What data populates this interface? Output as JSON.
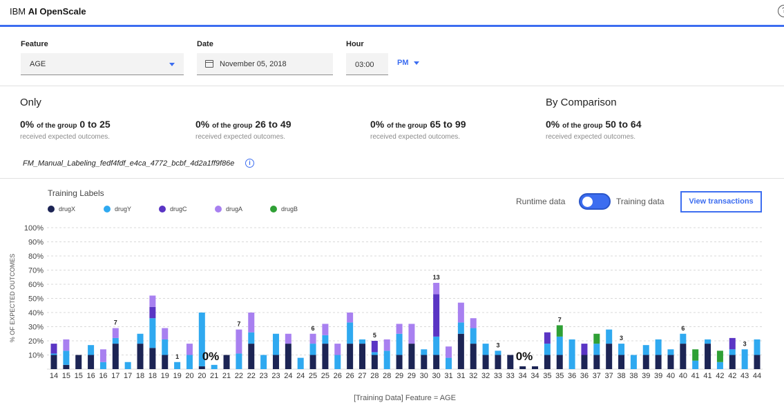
{
  "app": {
    "brand_prefix": "IBM",
    "brand_name": "AI OpenScale"
  },
  "filters": {
    "feature_label": "Feature",
    "feature_value": "AGE",
    "date_label": "Date",
    "date_value": "November 05, 2018",
    "hour_label": "Hour",
    "hour_value": "03:00",
    "ampm": "PM"
  },
  "summary": {
    "only_heading": "Only",
    "comparison_heading": "By Comparison",
    "groups": [
      {
        "pct": "0%",
        "of_the_group": "of the group",
        "range": "0 to 25",
        "sub": "received expected outcomes."
      },
      {
        "pct": "0%",
        "of_the_group": "of the group",
        "range": "26 to 49",
        "sub": "received expected outcomes."
      },
      {
        "pct": "0%",
        "of_the_group": "of the group",
        "range": "65 to 99",
        "sub": "received expected outcomes."
      },
      {
        "pct": "0%",
        "of_the_group": "of the group",
        "range": "50 to 64",
        "sub": "received expected outcomes."
      }
    ]
  },
  "model_name": "FM_Manual_Labeling_fedf4fdf_e4ca_4772_bcbf_4d2a1ff9f86e",
  "chart_header": {
    "title": "Training Labels",
    "runtime_label": "Runtime data",
    "training_label": "Training data",
    "toggle_on": "training",
    "view_button": "View transactions"
  },
  "colors": {
    "accent": "#3c6df0",
    "drugX": "#1c2454",
    "drugY": "#2fa9f0",
    "drugC": "#5a35c4",
    "drugA": "#a880f0",
    "drugB": "#2fa035"
  },
  "chart_data": {
    "type": "bar",
    "stacked": true,
    "ylabel": "% OF EXPECTED OUTCOMES",
    "xlabel": "[Training Data] Feature = AGE",
    "ylim": [
      0,
      100
    ],
    "yticks": [
      "10%",
      "20%",
      "30%",
      "40%",
      "50%",
      "60%",
      "70%",
      "80%",
      "90%",
      "100%"
    ],
    "grid": true,
    "legend": {
      "position": "top-left",
      "entries": [
        "drugX",
        "drugY",
        "drugC",
        "drugA",
        "drugB"
      ]
    },
    "bars": [
      {
        "x": "14",
        "s": [
          0,
          10,
          1,
          7,
          0,
          0
        ]
      },
      {
        "x": "15",
        "s": [
          1,
          3,
          10,
          0,
          8,
          0,
          0
        ]
      },
      {
        "x": "15",
        "s": [
          2,
          10,
          0,
          0,
          0,
          0
        ]
      },
      {
        "x": "16",
        "s": [
          3,
          10,
          7,
          0,
          0,
          0
        ]
      },
      {
        "x": "16",
        "s": [
          4,
          0,
          5,
          0,
          9,
          0
        ]
      },
      {
        "x": "17",
        "s": [
          5,
          18,
          4,
          0,
          7,
          0
        ],
        "label": "7"
      },
      {
        "x": "17",
        "s": [
          6,
          0,
          5,
          0,
          0,
          0
        ]
      },
      {
        "x": "18",
        "s": [
          7,
          18,
          7,
          0,
          0,
          0
        ]
      },
      {
        "x": "18",
        "s": [
          8,
          15,
          21,
          8,
          8,
          0
        ]
      },
      {
        "x": "19",
        "s": [
          9,
          10,
          11,
          0,
          8,
          0
        ]
      },
      {
        "x": "19",
        "s": [
          10,
          0,
          5,
          0,
          0,
          0
        ],
        "label": "1"
      },
      {
        "x": "20",
        "s": [
          11,
          0,
          10,
          0,
          8,
          0
        ]
      },
      {
        "x": "20",
        "s": [
          12,
          2,
          38,
          0,
          0,
          0
        ]
      },
      {
        "x": "21",
        "s": [
          13,
          0,
          3,
          0,
          0,
          0
        ]
      },
      {
        "x": "21",
        "s": [
          14,
          10,
          0,
          0,
          0,
          0
        ]
      },
      {
        "x": "22",
        "s": [
          15,
          0,
          11,
          0,
          17,
          0
        ],
        "label": "7"
      },
      {
        "x": "22",
        "s": [
          16,
          18,
          8,
          0,
          14,
          0
        ]
      },
      {
        "x": "23",
        "s": [
          17,
          0,
          10,
          0,
          0,
          0
        ]
      },
      {
        "x": "23",
        "s": [
          18,
          10,
          15,
          0,
          0,
          0
        ]
      },
      {
        "x": "24",
        "s": [
          19,
          18,
          0,
          0,
          7,
          0
        ]
      },
      {
        "x": "24",
        "s": [
          20,
          0,
          8,
          0,
          0,
          0
        ]
      },
      {
        "x": "25",
        "s": [
          21,
          10,
          8,
          0,
          7,
          0
        ],
        "label": "6"
      },
      {
        "x": "25",
        "s": [
          22,
          18,
          6,
          0,
          8,
          0
        ]
      },
      {
        "x": "26",
        "s": [
          23,
          0,
          10,
          0,
          8,
          0
        ]
      },
      {
        "x": "26",
        "s": [
          24,
          18,
          15,
          0,
          7,
          0
        ]
      },
      {
        "x": "27",
        "s": [
          25,
          18,
          3,
          0,
          0,
          0
        ]
      },
      {
        "x": "28",
        "s": [
          26,
          10,
          2,
          8,
          0,
          0
        ],
        "label": "5"
      },
      {
        "x": "28",
        "s": [
          27,
          0,
          13,
          0,
          8,
          0
        ]
      },
      {
        "x": "29",
        "s": [
          28,
          10,
          15,
          0,
          7,
          0
        ]
      },
      {
        "x": "29",
        "s": [
          29,
          18,
          0,
          0,
          14,
          0
        ]
      },
      {
        "x": "30",
        "s": [
          30,
          10,
          4,
          0,
          0,
          0
        ]
      },
      {
        "x": "30",
        "s": [
          31,
          10,
          13,
          30,
          8,
          0
        ],
        "label": "13"
      },
      {
        "x": "31",
        "s": [
          32,
          0,
          8,
          0,
          8,
          0
        ]
      },
      {
        "x": "31",
        "s": [
          33,
          25,
          8,
          0,
          14,
          0
        ]
      },
      {
        "x": "32",
        "s": [
          34,
          18,
          11,
          0,
          7,
          0
        ]
      },
      {
        "x": "32",
        "s": [
          35,
          10,
          8,
          0,
          0,
          0
        ]
      },
      {
        "x": "33",
        "s": [
          36,
          10,
          3,
          0,
          0,
          0
        ],
        "label": "3"
      },
      {
        "x": "33",
        "s": [
          37,
          10,
          0,
          0,
          0,
          0
        ]
      },
      {
        "x": "34",
        "s": [
          38,
          2,
          0,
          0,
          0,
          0
        ]
      },
      {
        "x": "34",
        "s": [
          39,
          2,
          0,
          0,
          0,
          0
        ]
      },
      {
        "x": "35",
        "s": [
          40,
          10,
          8,
          8,
          0,
          0
        ]
      },
      {
        "x": "35",
        "s": [
          41,
          10,
          13,
          0,
          0,
          8
        ],
        "label": "7"
      },
      {
        "x": "36",
        "s": [
          42,
          0,
          21,
          0,
          0,
          0
        ]
      },
      {
        "x": "36",
        "s": [
          43,
          10,
          0,
          8,
          0,
          0
        ]
      },
      {
        "x": "37",
        "s": [
          44,
          10,
          8,
          0,
          0,
          7
        ]
      },
      {
        "x": "37",
        "s": [
          45,
          18,
          10,
          0,
          0,
          0
        ]
      },
      {
        "x": "38",
        "s": [
          46,
          10,
          8,
          0,
          0,
          0
        ],
        "label": "3"
      },
      {
        "x": "38",
        "s": [
          47,
          0,
          10,
          0,
          0,
          0
        ]
      },
      {
        "x": "39",
        "s": [
          48,
          10,
          7,
          0,
          0,
          0
        ]
      },
      {
        "x": "39",
        "s": [
          49,
          10,
          11,
          0,
          0,
          0
        ]
      },
      {
        "x": "40",
        "s": [
          50,
          10,
          4,
          0,
          0,
          0
        ]
      },
      {
        "x": "40",
        "s": [
          51,
          18,
          7,
          0,
          0,
          0
        ],
        "label": "6"
      },
      {
        "x": "41",
        "s": [
          52,
          0,
          6,
          0,
          0,
          8
        ]
      },
      {
        "x": "41",
        "s": [
          53,
          18,
          3,
          0,
          0,
          0
        ]
      },
      {
        "x": "42",
        "s": [
          54,
          0,
          5,
          0,
          0,
          8
        ]
      },
      {
        "x": "42",
        "s": [
          55,
          10,
          4,
          8,
          0,
          0
        ]
      },
      {
        "x": "43",
        "s": [
          56,
          0,
          14,
          0,
          0,
          0
        ],
        "label": "3"
      },
      {
        "x": "44",
        "s": [
          57,
          10,
          11,
          0,
          0,
          0
        ]
      }
    ],
    "bars_note": "",
    "zero_annotations": [
      {
        "text": "0%",
        "near": "20-21"
      },
      {
        "text": "0%",
        "near": "33-34"
      }
    ]
  }
}
